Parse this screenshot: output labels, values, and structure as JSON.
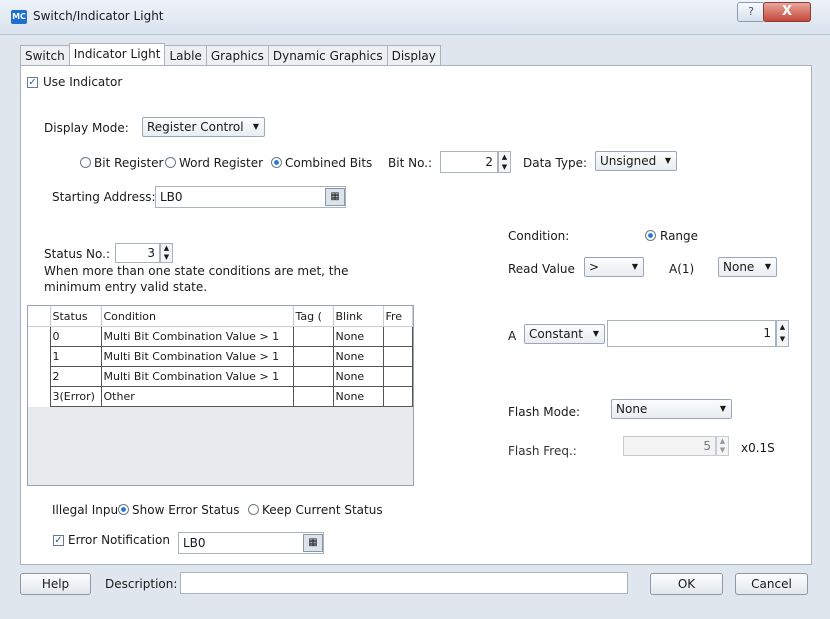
{
  "window": {
    "title": "Switch/Indicator Light",
    "app_icon": "MC",
    "help_glyph": "?",
    "close_glyph": "X"
  },
  "tabs": [
    "Switch",
    "Indicator Light",
    "Lable",
    "Graphics",
    "Dynamic Graphics",
    "Display"
  ],
  "use_indicator": {
    "label": "Use Indicator",
    "checked": true
  },
  "display_mode": {
    "label": "Display Mode:",
    "value": "Register Control"
  },
  "register_type": {
    "bit": "Bit Register",
    "word": "Word Register",
    "combined": "Combined Bits",
    "selected": "Combined Bits"
  },
  "bit_no": {
    "label": "Bit No.:",
    "value": "2"
  },
  "data_type": {
    "label": "Data Type:",
    "value": "Unsigned"
  },
  "starting_address": {
    "label": "Starting Address:",
    "value": "LB0"
  },
  "status_no": {
    "label": "Status No.:",
    "value": "3"
  },
  "note": "When more than one state conditions are met, the minimum entry valid state.",
  "table": {
    "headers": [
      "Status",
      "Condition",
      "Tag (",
      "Blink",
      "Fre"
    ],
    "rows": [
      [
        "0",
        "Multi Bit Combination Value > 1",
        "",
        "None",
        ""
      ],
      [
        "1",
        "Multi Bit Combination Value > 1",
        "",
        "None",
        ""
      ],
      [
        "2",
        "Multi Bit Combination Value > 1",
        "",
        "None",
        ""
      ],
      [
        "3(Error)",
        "Other",
        "",
        "None",
        ""
      ]
    ]
  },
  "condition": {
    "label": "Condition:",
    "range_label": "Range"
  },
  "read_value": {
    "label": "Read Value",
    "operator": ">",
    "a1_label": "A(1)",
    "a1_value": "None"
  },
  "a_field": {
    "label": "A",
    "source": "Constant",
    "value": "1"
  },
  "flash_mode": {
    "label": "Flash Mode:",
    "value": "None"
  },
  "flash_freq": {
    "label": "Flash Freq.:",
    "value": "5",
    "unit": "x0.1S"
  },
  "illegal_input": {
    "label": "Illegal Input",
    "show_error": "Show Error Status",
    "keep_current": "Keep Current Status"
  },
  "error_notification": {
    "label": "Error Notification",
    "checked": true,
    "value": "LB0"
  },
  "footer": {
    "help": "Help",
    "description_label": "Description:",
    "description_value": "",
    "ok": "OK",
    "cancel": "Cancel"
  }
}
